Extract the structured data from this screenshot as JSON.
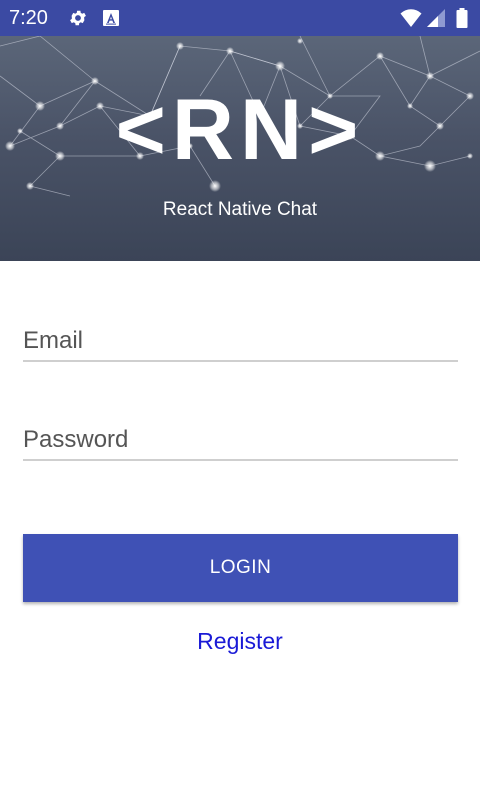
{
  "status_bar": {
    "time": "7:20",
    "icons": [
      "gear-icon",
      "a-icon",
      "wifi-icon",
      "signal-icon",
      "battery-icon"
    ],
    "background": "#3b4aa3"
  },
  "header": {
    "logo_text": "<RN>",
    "tagline": "React Native Chat"
  },
  "form": {
    "email_placeholder": "Email",
    "email_value": "",
    "password_placeholder": "Password",
    "password_value": "",
    "login_label": "LOGIN",
    "register_label": "Register"
  },
  "colors": {
    "primary": "#3f51b5",
    "link": "#1a1ad6",
    "underline": "#cfcfcf"
  }
}
